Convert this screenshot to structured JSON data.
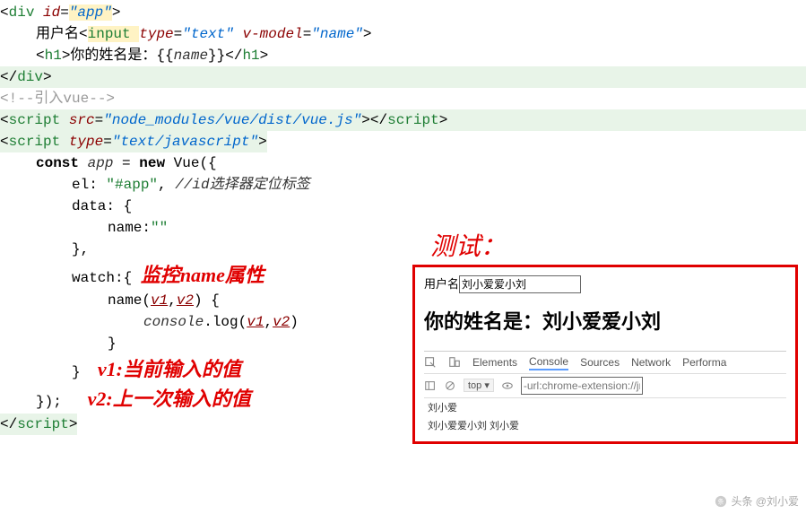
{
  "code": {
    "l1": {
      "p1": "<",
      "tag": "div ",
      "attr": "id",
      "eq": "=",
      "val": "\"app\"",
      "p2": ">"
    },
    "l2": {
      "text": "用户名",
      "p1": "<",
      "tag": "input ",
      "attr1": "type",
      "val1": "\"text\" ",
      "attr2": "v-model",
      "val2": "\"name\"",
      "p2": ">"
    },
    "l3": {
      "p1a": "<",
      "tag1": "h1",
      "p1b": ">",
      "txt": "你的姓名是：{{",
      "var": "name",
      "txt2": "}}",
      "p2a": "</",
      "tag2": "h1",
      "p2b": ">"
    },
    "l4": {
      "p1": "</",
      "tag": "div",
      "p2": ">"
    },
    "l5": "<!--引入vue-->",
    "l6": {
      "p1": "<",
      "tag": "script ",
      "attr": "src",
      "val": "\"node_modules/vue/dist/vue.js\"",
      "p2": ">",
      "p3": "</",
      "tag2": "script",
      "p4": ">"
    },
    "l7": {
      "p1": "<",
      "tag": "script ",
      "attr": "type",
      "val": "\"text/javascript\"",
      "p2": ">"
    },
    "l8": {
      "kw1": "const ",
      "var": "app",
      "eq": " = ",
      "kw2": "new ",
      "fn": "Vue",
      "paren": "({"
    },
    "l9": {
      "k": "el: ",
      "v": "\"#app\"",
      "comma": ", ",
      "comment": "//id选择器定位标签"
    },
    "l10": {
      "k": "data: {"
    },
    "l11": {
      "k": "name:",
      "v": "\"\""
    },
    "l12": "},",
    "l13": {
      "k": "watch:{ ",
      "anno": "监控name属性"
    },
    "l14": {
      "fn": "name",
      "p1": "(",
      "v1": "v1",
      "comma": ",",
      "v2": "v2",
      "p2": ") {"
    },
    "l15": {
      "obj": "console",
      "dot": ".",
      "fn": "log",
      "p1": "(",
      "v1": "v1",
      "comma": ",",
      "v2": "v2",
      "p2": ")"
    },
    "l16": "}",
    "l17": {
      "close": "}",
      "anno": "v1:当前输入的值"
    },
    "l18": {
      "close": "});",
      "anno": "v2:上一次输入的值"
    },
    "l19": {
      "p1": "</",
      "tag": "script",
      "p2": ">"
    }
  },
  "test": {
    "label": "测试：",
    "form_label": "用户名",
    "input_value": "刘小爱爱小刘",
    "h1": "你的姓名是：刘小爱爱小刘"
  },
  "devtools": {
    "tabs": [
      "Elements",
      "Console",
      "Sources",
      "Network",
      "Performa"
    ],
    "active_tab": "Console",
    "dropdown": "top",
    "filter": "-url:chrome-extension://jm",
    "logs": [
      "刘小爱",
      "刘小爱爱小刘 刘小爱"
    ]
  },
  "watermark": "头条 @刘小爱"
}
